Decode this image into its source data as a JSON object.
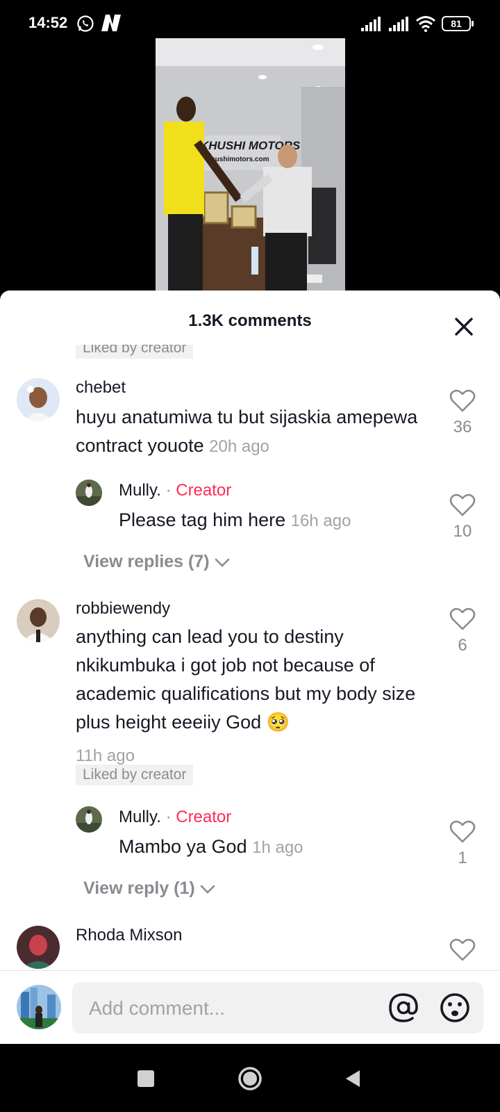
{
  "status_bar": {
    "time": "14:52",
    "battery": "81"
  },
  "sheet": {
    "title": "1.3K comments"
  },
  "comments": [
    {
      "top_badge": "Liked by creator"
    },
    {
      "username": "chebet",
      "text": "huyu anatumiwa tu but sijaskia amepewa contract youote",
      "time": "20h ago",
      "likes": "36",
      "reply": {
        "username": "Mully.",
        "separator": "·",
        "creator_label": "Creator",
        "text": "Please tag him here",
        "time": "16h ago",
        "likes": "10"
      },
      "view_replies": "View replies (7)"
    },
    {
      "username": "robbiewendy",
      "text": "anything can lead you to destiny nkikumbuka i got job not because of academic qualifications but my body size plus height eeeiiy God 🥺",
      "time": "11h ago",
      "badge": "Liked by creator",
      "likes": "6",
      "reply": {
        "username": "Mully.",
        "separator": "·",
        "creator_label": "Creator",
        "text": "Mambo ya God",
        "time": "1h ago",
        "likes": "1"
      },
      "view_replies": "View reply (1)"
    },
    {
      "username": "Rhoda Mixson"
    }
  ],
  "input": {
    "placeholder": "Add comment..."
  },
  "video": {
    "sign_text": "KHUSHI MOTORS",
    "sign_url": "khushimotors.com"
  },
  "icons": {
    "status": [
      "whatsapp-icon",
      "n-app-icon",
      "signal-icon",
      "wifi-icon",
      "battery-icon"
    ],
    "sheet": [
      "close-icon",
      "heart-icon",
      "chevron-down-icon",
      "at-icon",
      "emoji-icon"
    ],
    "nav": [
      "recents-icon",
      "home-icon",
      "back-icon"
    ]
  },
  "colors": {
    "accent_creator": "#fe2c55",
    "text_primary": "#161823",
    "text_secondary": "#8a8b91"
  }
}
